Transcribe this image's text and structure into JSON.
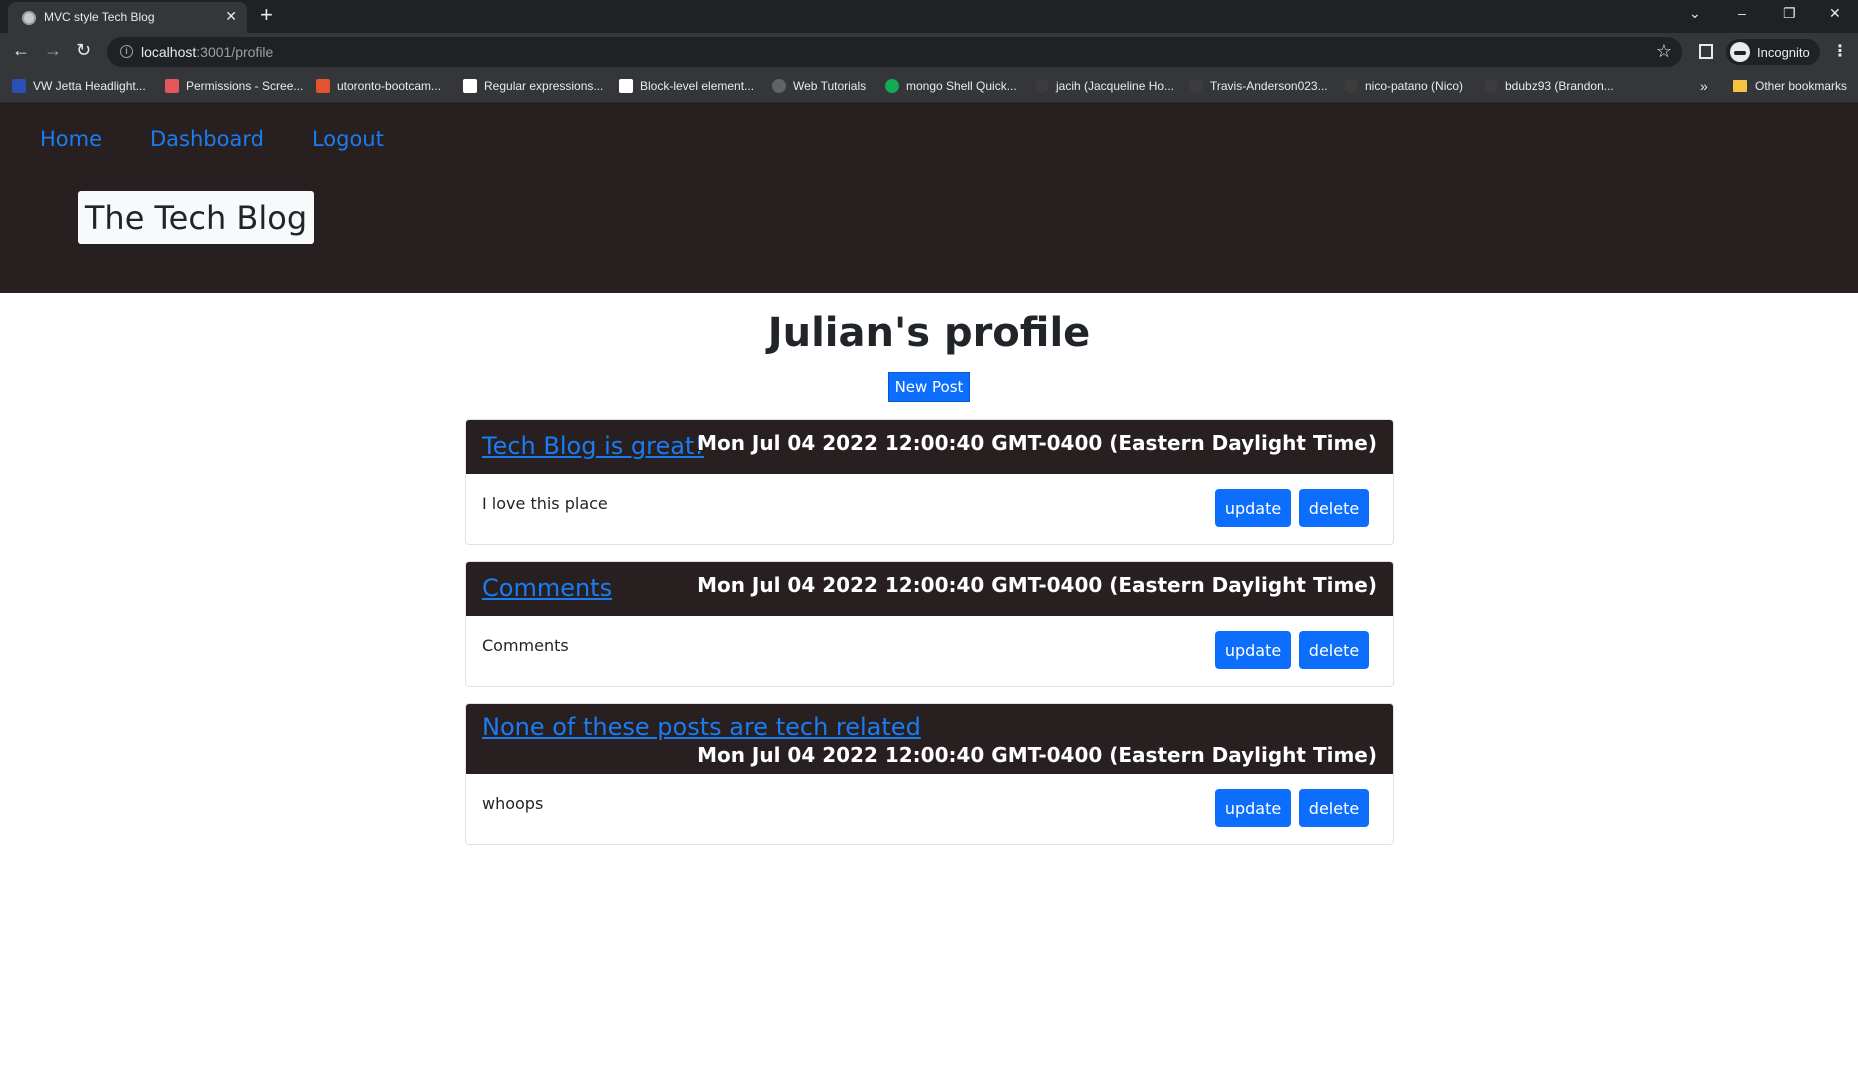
{
  "browser": {
    "tab_title": "MVC style Tech Blog",
    "tab_close": "✕",
    "new_tab": "+",
    "url_host": "localhost",
    "url_rest": ":3001/profile",
    "incognito_label": "Incognito",
    "window_controls": [
      "⌄",
      "–",
      "❐",
      "✕"
    ],
    "bookmarks": [
      {
        "label": "VW Jetta Headlight...",
        "icon_color": "#2a4fb5"
      },
      {
        "label": "Permissions - Scree...",
        "icon_color": "#e8555a"
      },
      {
        "label": "utoronto-bootcam...",
        "icon_color": "#e2532f"
      },
      {
        "label": "Regular expressions...",
        "icon_color": "#ffffff"
      },
      {
        "label": "Block-level element...",
        "icon_color": "#ffffff"
      },
      {
        "label": "Web Tutorials",
        "icon_color": "#5f6368"
      },
      {
        "label": "mongo Shell Quick...",
        "icon_color": "#13aa52"
      },
      {
        "label": "jacih (Jacqueline Ho...",
        "icon_color": "#3c3c3c"
      },
      {
        "label": "Travis-Anderson023...",
        "icon_color": "#3c3c3c"
      },
      {
        "label": "nico-patano (Nico)",
        "icon_color": "#3c3c3c"
      },
      {
        "label": "bdubz93 (Brandon...",
        "icon_color": "#3c3c3c"
      }
    ],
    "more_bookmarks": "»",
    "other_bookmarks": "Other bookmarks"
  },
  "site": {
    "nav": [
      "Home",
      "Dashboard",
      "Logout"
    ],
    "brand": "The Tech Blog"
  },
  "profile": {
    "title": "Julian's profile",
    "new_post_label": "New Post"
  },
  "posts": [
    {
      "title": "Tech Blog is great!",
      "date": "Mon Jul 04 2022 12:00:40 GMT-0400 (Eastern Daylight Time)",
      "body": "I love this place",
      "update_label": "update",
      "delete_label": "delete"
    },
    {
      "title": "Comments",
      "date": "Mon Jul 04 2022 12:00:40 GMT-0400 (Eastern Daylight Time)",
      "body": "Comments",
      "update_label": "update",
      "delete_label": "delete"
    },
    {
      "title": "None of these posts are tech related",
      "date": "Mon Jul 04 2022 12:00:40 GMT-0400 (Eastern Daylight Time)",
      "body": "whoops",
      "update_label": "update",
      "delete_label": "delete"
    }
  ],
  "colors": {
    "header_bg": "#271f20",
    "link": "#1b7cf2",
    "primary_button": "#0d6efd"
  }
}
